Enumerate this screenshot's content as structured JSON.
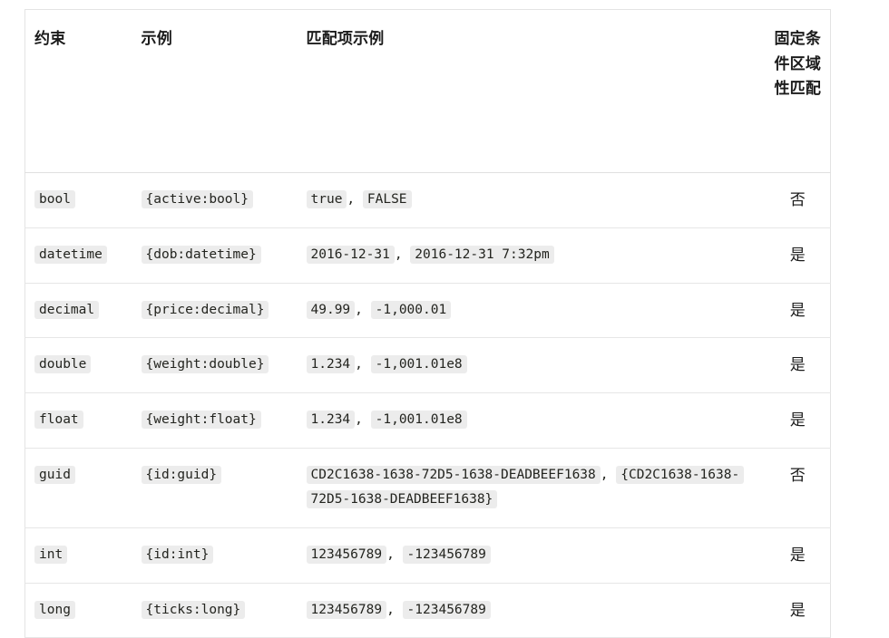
{
  "table": {
    "headers": [
      {
        "label": "约束",
        "name": "constraint"
      },
      {
        "label": "示例",
        "name": "example"
      },
      {
        "label": "匹配项示例",
        "name": "match-example"
      },
      {
        "label": "固定条件区域性匹配",
        "name": "invariant-culture-match"
      }
    ],
    "rows": [
      {
        "constraint": "bool",
        "example": "{active:bool}",
        "matches": [
          "true",
          "FALSE"
        ],
        "invariant": "否"
      },
      {
        "constraint": "datetime",
        "example": "{dob:datetime}",
        "matches": [
          "2016-12-31",
          "2016-12-31 7:32pm"
        ],
        "invariant": "是"
      },
      {
        "constraint": "decimal",
        "example": "{price:decimal}",
        "matches": [
          "49.99",
          "-1,000.01"
        ],
        "invariant": "是"
      },
      {
        "constraint": "double",
        "example": "{weight:double}",
        "matches": [
          "1.234",
          "-1,001.01e8"
        ],
        "invariant": "是"
      },
      {
        "constraint": "float",
        "example": "{weight:float}",
        "matches": [
          "1.234",
          "-1,001.01e8"
        ],
        "invariant": "是"
      },
      {
        "constraint": "guid",
        "example": "{id:guid}",
        "matches": [
          "CD2C1638-1638-72D5-1638-DEADBEEF1638",
          "{CD2C1638-1638-72D5-1638-DEADBEEF1638}"
        ],
        "invariant": "否"
      },
      {
        "constraint": "int",
        "example": "{id:int}",
        "matches": [
          "123456789",
          "-123456789"
        ],
        "invariant": "是"
      },
      {
        "constraint": "long",
        "example": "{ticks:long}",
        "matches": [
          "123456789",
          "-123456789"
        ],
        "invariant": "是"
      }
    ],
    "separator": ", "
  },
  "colors": {
    "page_background": "#ffffff",
    "text": "#1b1b1b",
    "code_background": "#ececec",
    "code_text": "#23241f",
    "border": "#e3e3e3",
    "row_border": "#e6e6e6"
  }
}
